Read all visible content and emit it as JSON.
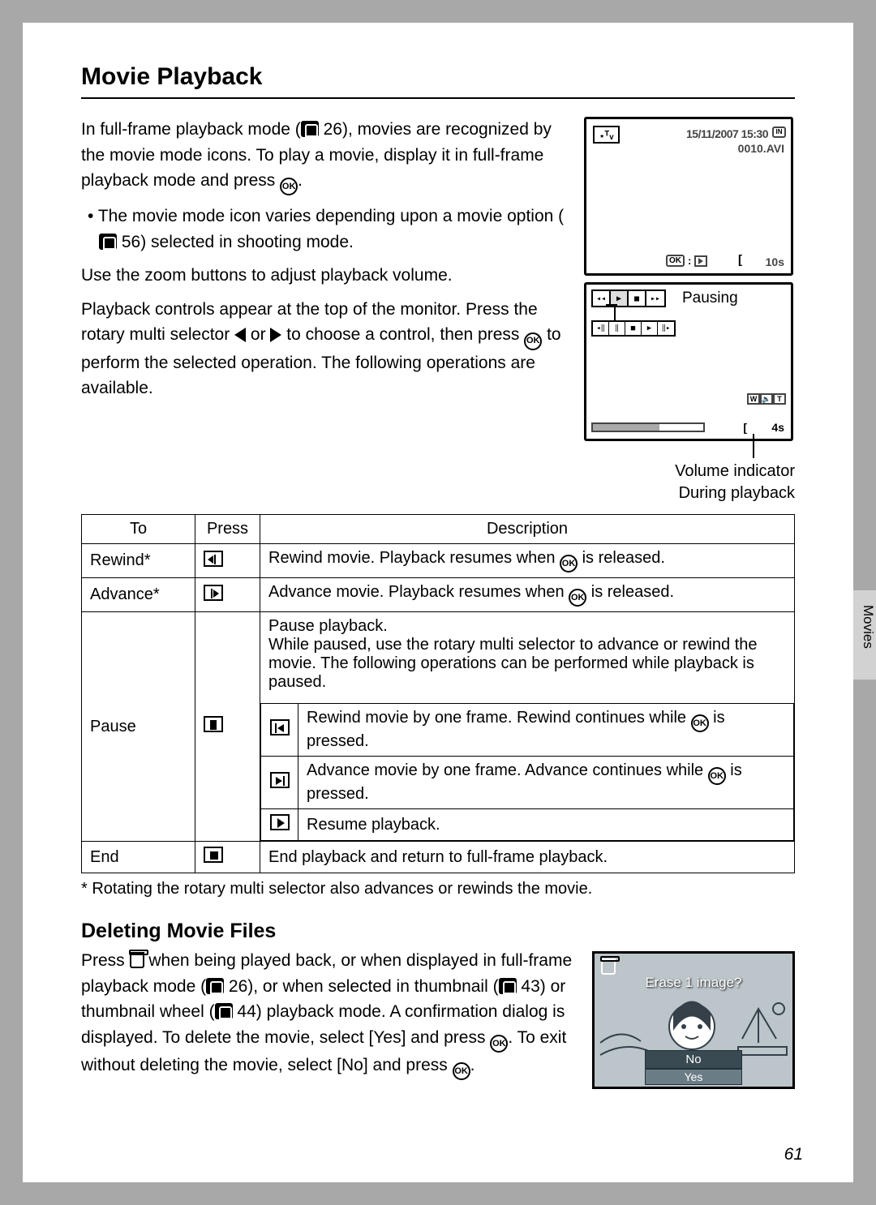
{
  "heading": "Movie Playback",
  "intro": {
    "p1a": "In full-frame playback mode (",
    "p1_ref1": " 26), movies are recognized by the movie mode icons. To play a movie, display it in full-frame playback mode and press ",
    "p1_end": ".",
    "bullet": "The movie mode icon varies depending upon a movie option (",
    "bullet_ref": " 56) selected in shooting mode.",
    "p2": "Use the zoom buttons to adjust playback volume.",
    "p3a": "Playback controls appear at the top of the monitor. Press the rotary multi selector ",
    "p3b": " or ",
    "p3c": " to choose a control, then press ",
    "p3d": " to perform the selected operation. The following operations are available."
  },
  "lcd1": {
    "tv": "ᵀᵥ",
    "date": "15/11/2007 15:30",
    "in": "IN",
    "file": "0010.AVI",
    "ok": "OK",
    "colon": ":",
    "time": "10s"
  },
  "lcd2": {
    "pausing": "Pausing",
    "time": "4s"
  },
  "fig_caption_l1": "Volume indicator",
  "fig_caption_l2": "During playback",
  "table": {
    "h1": "To",
    "h2": "Press",
    "h3": "Description",
    "r1_to": "Rewind*",
    "r1_desc_a": "Rewind movie. Playback resumes when ",
    "r1_desc_b": " is released.",
    "r2_to": "Advance*",
    "r2_desc_a": "Advance movie. Playback resumes when ",
    "r2_desc_b": " is released.",
    "r3_to": "Pause",
    "r3_top": "Pause playback.\nWhile paused, use the rotary multi selector to advance or rewind the movie. The following operations can be performed while playback is paused.",
    "r3_sub1_a": "Rewind movie by one frame. Rewind continues while ",
    "r3_sub1_b": " is pressed.",
    "r3_sub2_a": "Advance movie by one frame. Advance continues while ",
    "r3_sub2_b": " is pressed.",
    "r3_sub3": "Resume playback.",
    "r4_to": "End",
    "r4_desc": "End playback and return to full-frame playback."
  },
  "footnote": "*  Rotating the rotary multi selector also advances or rewinds the movie.",
  "subheading": "Deleting Movie Files",
  "delete": {
    "a": "Press ",
    "b": " when being played back, or when displayed in full-frame playback mode (",
    "ref1": " 26), or when selected in thumbnail (",
    "ref2": " 43) or thumbnail wheel (",
    "ref3": " 44) playback mode. A confirmation dialog is displayed. To delete the movie, select [Yes] and press ",
    "c": ". To exit without deleting the movie, select [No] and press ",
    "d": "."
  },
  "dialog": {
    "q": "Erase 1 image?",
    "no": "No",
    "yes": "Yes"
  },
  "ok_label": "OK",
  "page_num": "61",
  "side_tab": "Movies"
}
